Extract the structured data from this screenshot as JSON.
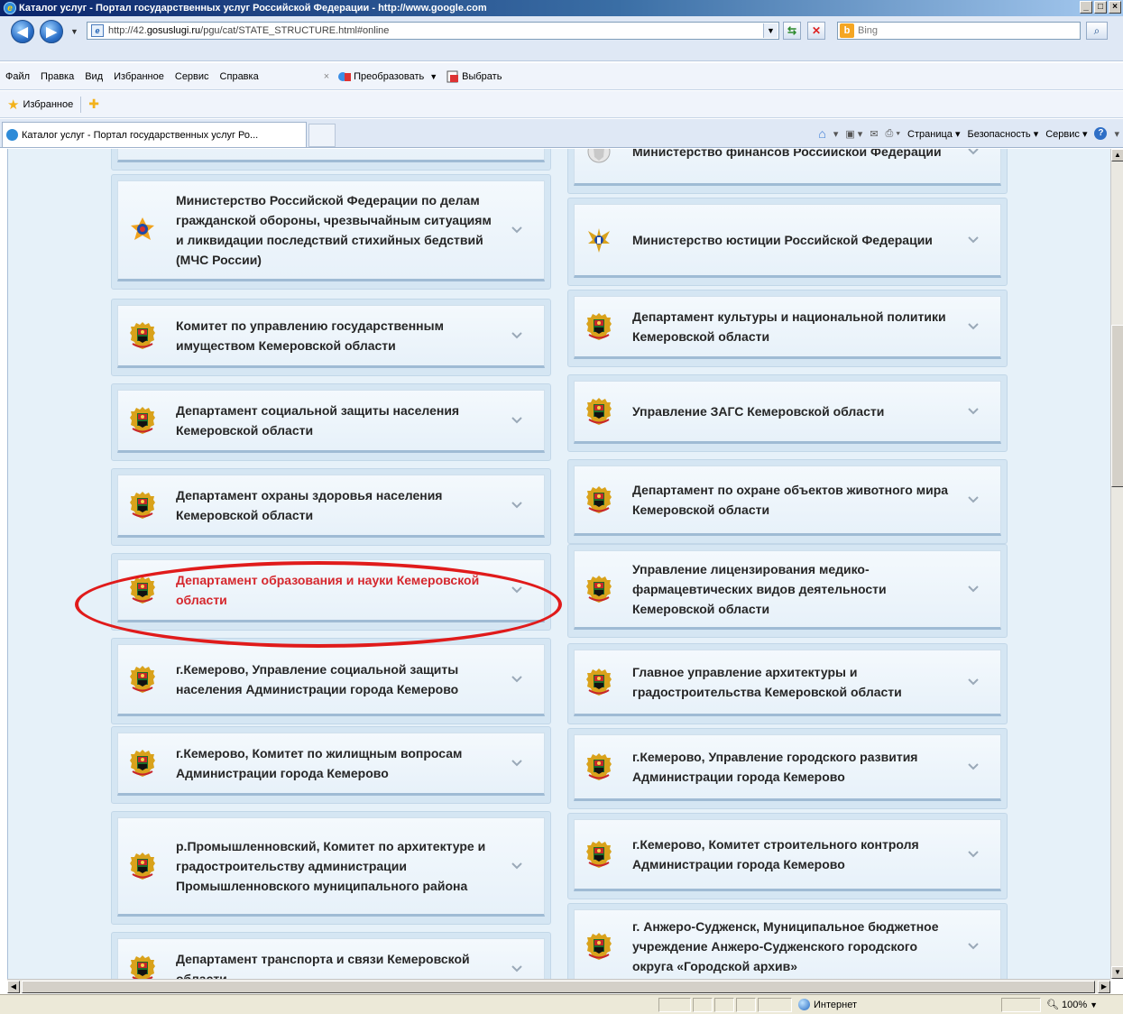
{
  "window": {
    "title": "Каталог услуг - Портал государственных услуг Российской Федерации - http://www.google.com",
    "url_prefix": "http://42.",
    "url_host": "gosuslugi.ru",
    "url_path": "/pgu/cat/STATE_STRUCTURE.html#online",
    "search_placeholder": "Bing"
  },
  "menu": {
    "items": [
      "Файл",
      "Правка",
      "Вид",
      "Избранное",
      "Сервис",
      "Справка"
    ],
    "convert_label": "Преобразовать",
    "select_label": "Выбрать"
  },
  "favorites": {
    "label": "Избранное"
  },
  "tab": {
    "title": "Каталог услуг - Портал государственных услуг Ро..."
  },
  "commandbar": {
    "page": "Страница",
    "safety": "Безопасность",
    "tools": "Сервис"
  },
  "cards_left": [
    {
      "text": "",
      "partial": true
    },
    {
      "text": "Министерство Российской Федерации по делам гражданской обороны, чрезвычайным ситуациям и ликвидации последствий стихийных бедствий (МЧС России)",
      "emblem": "mchs"
    },
    {
      "text": "Комитет по управлению государственным имуществом Кемеровской области",
      "emblem": "kemerovo"
    },
    {
      "text": "Департамент социальной защиты населения Кемеровской области",
      "emblem": "kemerovo"
    },
    {
      "text": "Департамент охраны здоровья населения Кемеровской области",
      "emblem": "kemerovo"
    },
    {
      "text": "Департамент образования и науки Кемеровской области",
      "emblem": "kemerovo",
      "highlighted": true
    },
    {
      "text": "г.Кемерово, Управление социальной защиты населения Администрации города Кемерово",
      "emblem": "kemerovo"
    },
    {
      "text": "г.Кемерово, Комитет по жилищным вопросам Администрации города Кемерово",
      "emblem": "kemerovo"
    },
    {
      "text": "р.Промышленновский, Комитет по архитектуре и градостроительству администрации Промышленновского муниципального района",
      "emblem": "kemerovo"
    },
    {
      "text": "Департамент транспорта и связи Кемеровской области",
      "emblem": "kemerovo"
    }
  ],
  "cards_right": [
    {
      "text": "Министерство финансов Российской Федерации",
      "emblem": "minfin"
    },
    {
      "text": "Министерство юстиции Российской Федерации",
      "emblem": "minjust"
    },
    {
      "text": "Департамент культуры и национальной политики Кемеровской области",
      "emblem": "kemerovo"
    },
    {
      "text": "Управление ЗАГС Кемеровской области",
      "emblem": "kemerovo"
    },
    {
      "text": "Департамент по охране объектов животного мира Кемеровской области",
      "emblem": "kemerovo"
    },
    {
      "text": "Управление лицензирования медико-фармацевтических видов деятельности Кемеровской области",
      "emblem": "kemerovo"
    },
    {
      "text": "Главное управление архитектуры и градостроительства Кемеровской области",
      "emblem": "kemerovo"
    },
    {
      "text": "г.Кемерово, Управление городского развития Администрации города Кемерово",
      "emblem": "kemerovo"
    },
    {
      "text": "г.Кемерово, Комитет строительного контроля Администрации города Кемерово",
      "emblem": "kemerovo"
    },
    {
      "text": "г. Анжеро-Судженск, Муниципальное бюджетное учреждение Анжеро-Судженского городского округа «Городской архив»",
      "emblem": "kemerovo"
    }
  ],
  "status": {
    "zone": "Интернет",
    "zoom": "100%"
  },
  "colors": {
    "highlight_text": "#d5272d",
    "annotation_ellipse": "#e01b1b",
    "page_bg": "#e6f1f9"
  }
}
